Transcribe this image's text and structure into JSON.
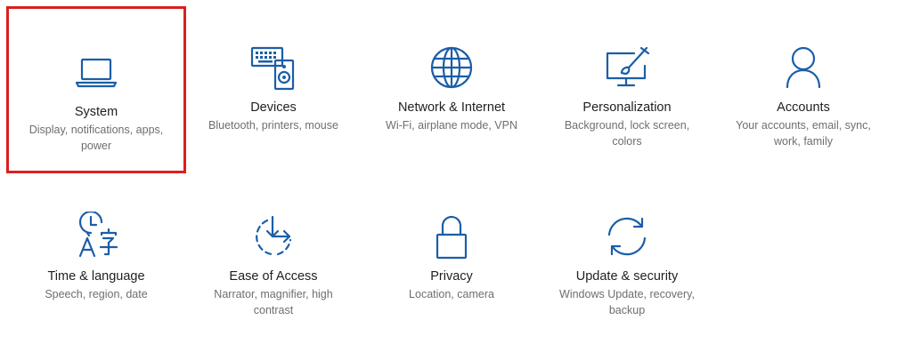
{
  "colors": {
    "accent": "#1b5ea8",
    "title_text": "#1f1f1f",
    "desc_text": "#6e6e6e",
    "selection_border": "#d9201f"
  },
  "tiles": [
    {
      "title": "System",
      "desc": "Display, notifications, apps, power",
      "icon": "laptop-icon",
      "selected": true
    },
    {
      "title": "Devices",
      "desc": "Bluetooth, printers, mouse",
      "icon": "keyboard-speaker-icon"
    },
    {
      "title": "Network & Internet",
      "desc": "Wi-Fi, airplane mode, VPN",
      "icon": "globe-icon"
    },
    {
      "title": "Personalization",
      "desc": "Background, lock screen, colors",
      "icon": "monitor-brush-icon"
    },
    {
      "title": "Accounts",
      "desc": "Your accounts, email, sync, work, family",
      "icon": "person-icon"
    },
    {
      "title": "Time & language",
      "desc": "Speech, region, date",
      "icon": "clock-language-icon"
    },
    {
      "title": "Ease of Access",
      "desc": "Narrator, magnifier, high contrast",
      "icon": "ease-of-access-icon"
    },
    {
      "title": "Privacy",
      "desc": "Location, camera",
      "icon": "lock-icon"
    },
    {
      "title": "Update & security",
      "desc": "Windows Update, recovery, backup",
      "icon": "sync-arrows-icon"
    }
  ]
}
